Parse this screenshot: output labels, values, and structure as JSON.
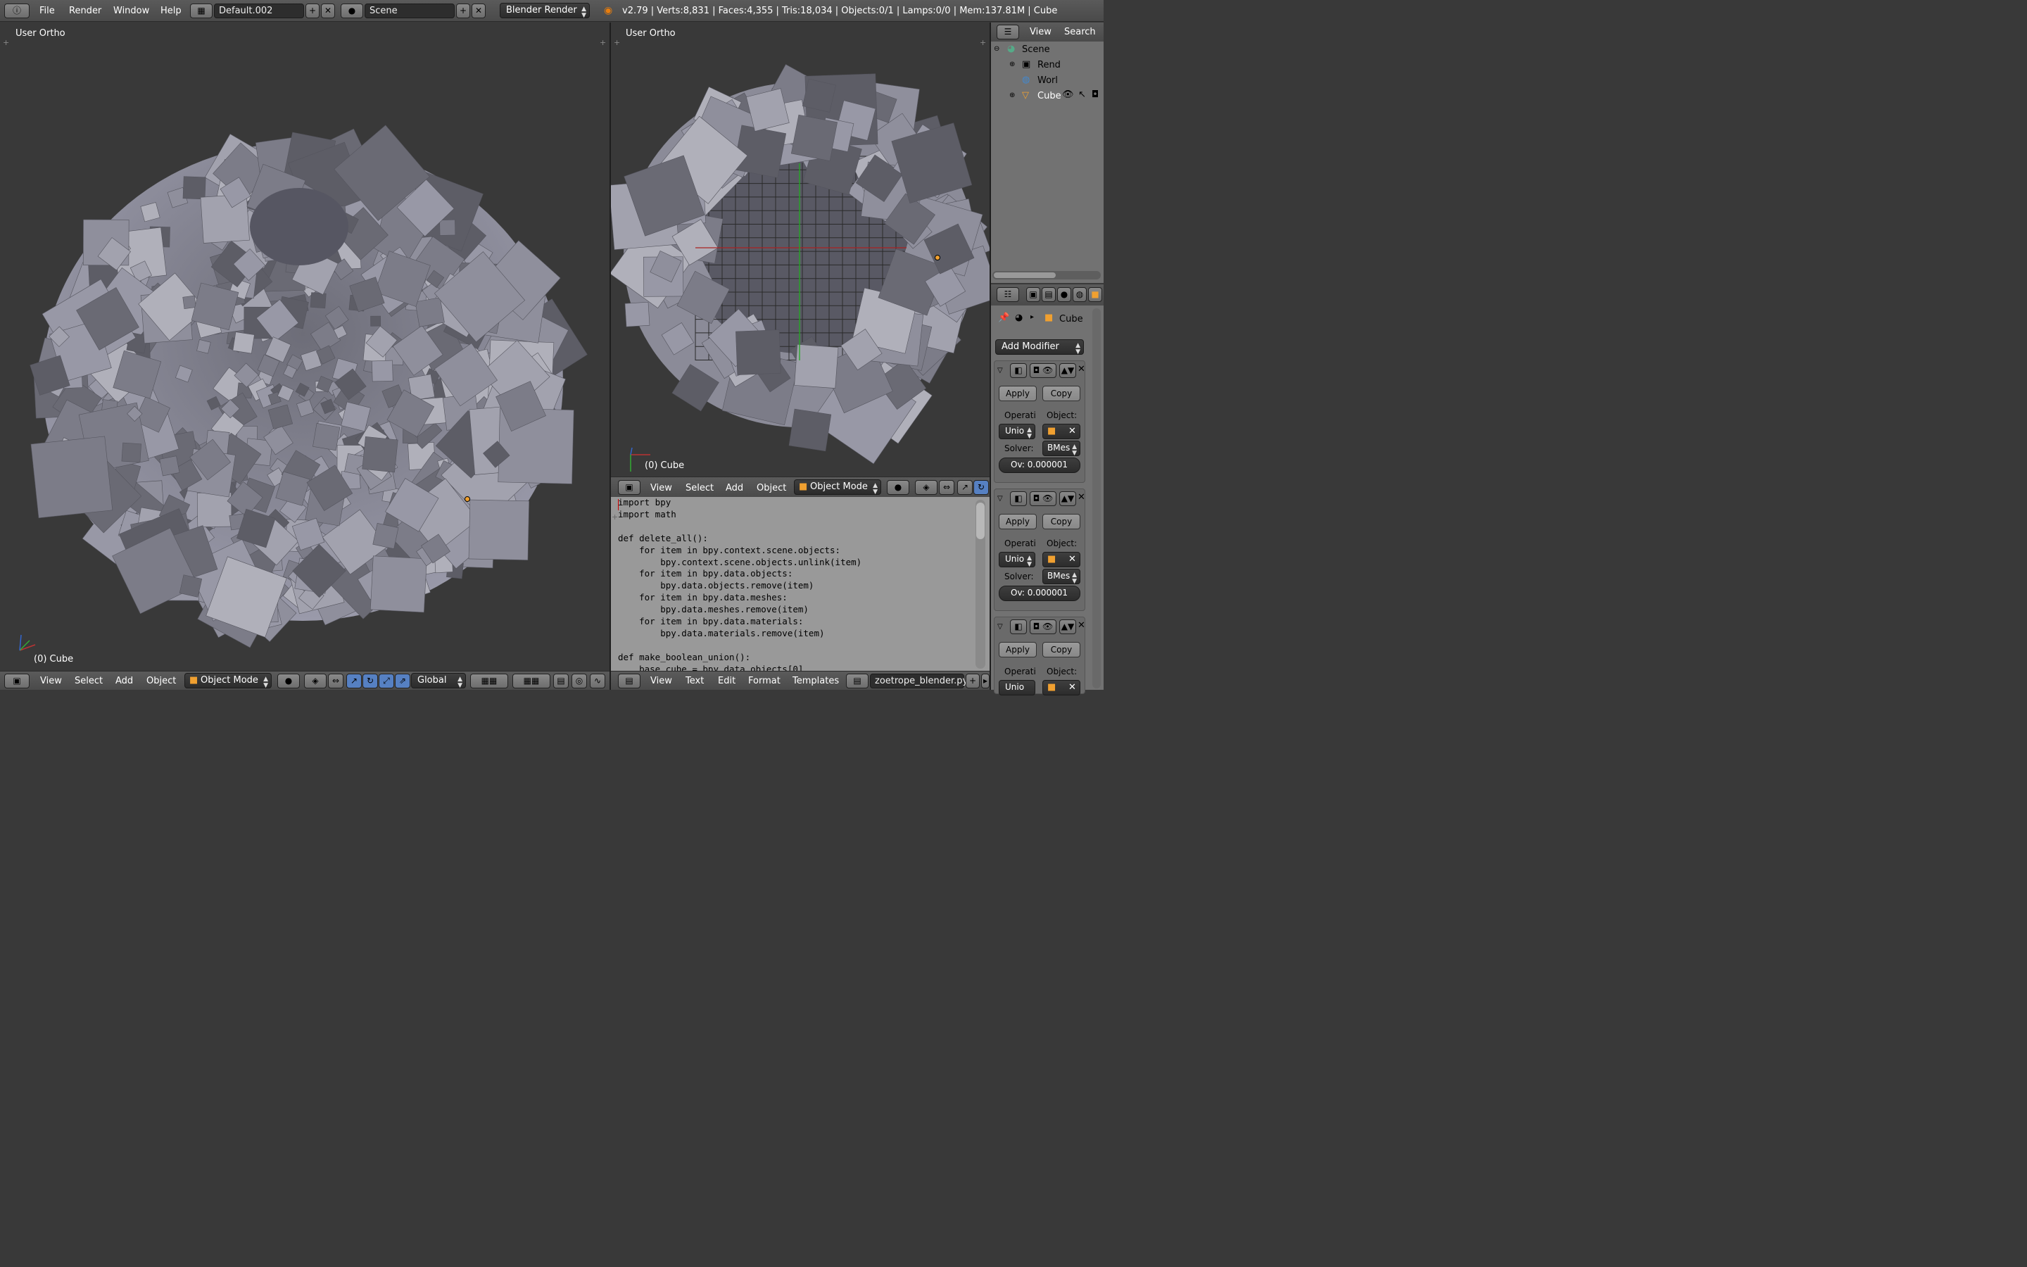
{
  "topbar": {
    "menus": [
      "File",
      "Render",
      "Window",
      "Help"
    ],
    "layout": "Default.002",
    "scene": "Scene",
    "engine": "Blender Render",
    "stats": "v2.79 | Verts:8,831 | Faces:4,355 | Tris:18,034 | Objects:0/1 | Lamps:0/0 | Mem:137.81M | Cube"
  },
  "viewport_left": {
    "view_name": "User Ortho",
    "object_label": "(0) Cube",
    "header": {
      "view": "View",
      "select": "Select",
      "add": "Add",
      "object": "Object",
      "mode": "Object Mode",
      "orientation": "Global"
    }
  },
  "viewport_right": {
    "view_name": "User Ortho",
    "object_label": "(0) Cube",
    "header": {
      "view": "View",
      "select": "Select",
      "add": "Add",
      "object": "Object",
      "mode": "Object Mode"
    }
  },
  "text_editor": {
    "lines": [
      "import bpy",
      "import math",
      "",
      "def delete_all():",
      "    for item in bpy.context.scene.objects:",
      "        bpy.context.scene.objects.unlink(item)",
      "    for item in bpy.data.objects:",
      "        bpy.data.objects.remove(item)",
      "    for item in bpy.data.meshes:",
      "        bpy.data.meshes.remove(item)",
      "    for item in bpy.data.materials:",
      "        bpy.data.materials.remove(item)",
      "",
      "def make_boolean_union():",
      "    base_cube = bpy.data.objects[0]"
    ],
    "header": {
      "view": "View",
      "text": "Text",
      "edit": "Edit",
      "format": "Format",
      "templates": "Templates",
      "filename": "zoetrope_blender.py"
    }
  },
  "outliner": {
    "header": {
      "view": "View",
      "search": "Search"
    },
    "items": [
      "Scene",
      "Rend",
      "Worl",
      "Cube"
    ]
  },
  "properties": {
    "breadcrumb": "Cube",
    "add_modifier": "Add Modifier",
    "modifiers": [
      {
        "apply": "Apply",
        "copy": "Copy",
        "operation_label": "Operati",
        "object_label": "Object:",
        "operation": "Unio",
        "solver_label": "Solver:",
        "solver": "BMes",
        "overlap": "Ov: 0.000001"
      },
      {
        "apply": "Apply",
        "copy": "Copy",
        "operation_label": "Operati",
        "object_label": "Object:",
        "operation": "Unio",
        "solver_label": "Solver:",
        "solver": "BMes",
        "overlap": "Ov: 0.000001"
      },
      {
        "apply": "Apply",
        "copy": "Copy",
        "operation_label": "Operati",
        "object_label": "Object:",
        "operation": "Unio"
      }
    ]
  },
  "colors": {
    "background": "#393939",
    "accent": "#5680c2",
    "panel": "#727272",
    "text_bg": "#999999",
    "cube": "#8a8a98"
  }
}
